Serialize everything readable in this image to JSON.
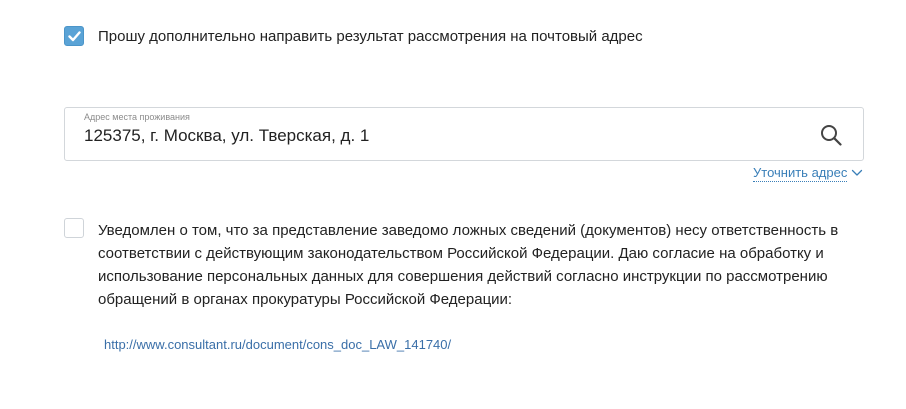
{
  "postal_option": {
    "checked": true,
    "label": "Прошу дополнительно направить результат рассмотрения на почтовый адрес"
  },
  "address": {
    "caption": "Адрес места проживания",
    "value": "125375, г. Москва, ул. Тверская, д. 1",
    "search_icon": "search-icon",
    "clarify_label": "Уточнить адрес",
    "clarify_icon": "chevron-down-icon"
  },
  "consent": {
    "checked": false,
    "lines": [
      "Уведомлен о том, что за представление заведомо ложных сведений (документов) несу ответственность в",
      "соответствии с действующим законодательством Российской Федерации. Даю согласие на обработку и",
      "использование персональных данных для совершения действий согласно инструкции по рассмотрению",
      "обращений в органах прокуратуры Российской Федерации:"
    ],
    "link_text": "http://www.consultant.ru/document/cons_doc_LAW_141740/"
  },
  "colors": {
    "accent": "#5aa3d6",
    "link": "#3a7fb8",
    "border": "#d3d7db",
    "text": "#222222"
  }
}
